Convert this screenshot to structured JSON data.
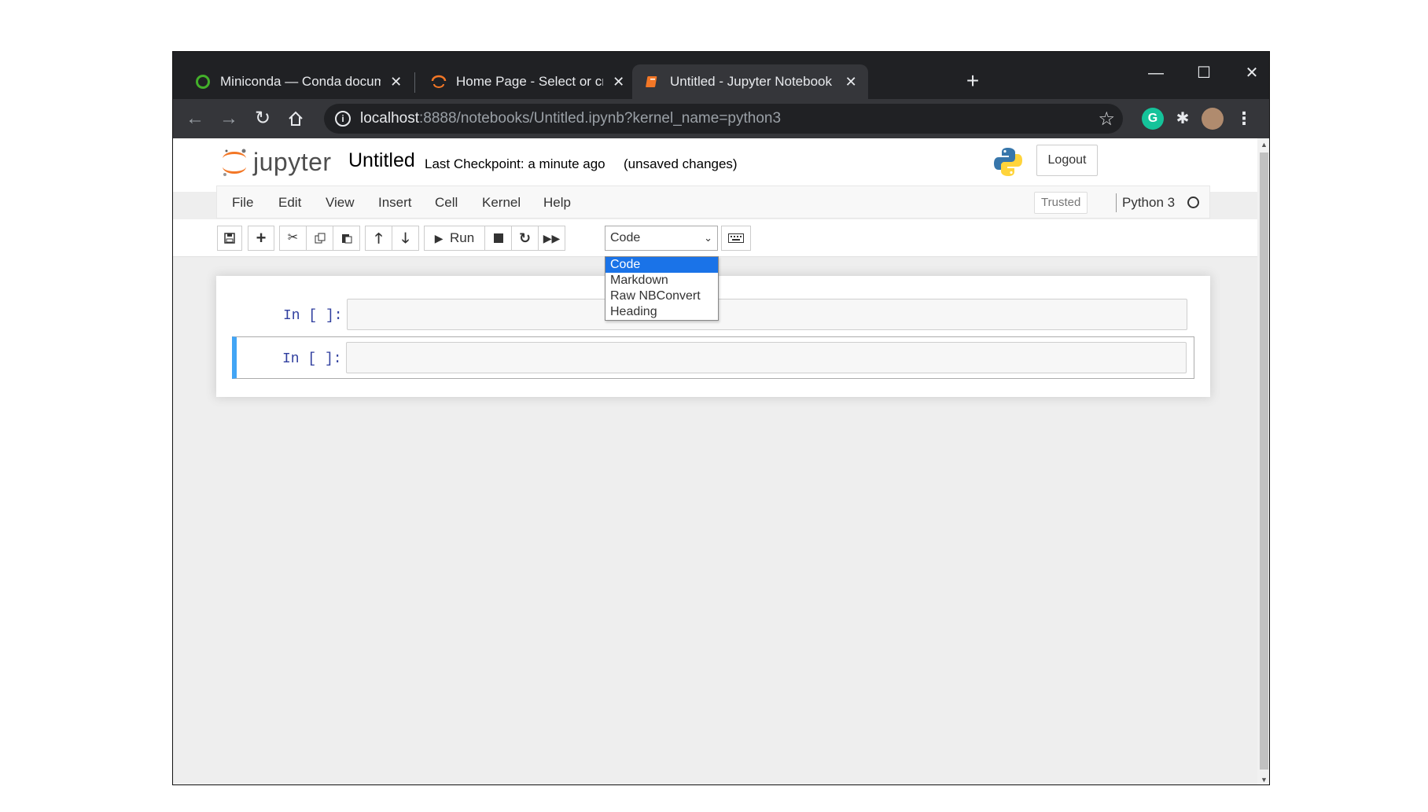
{
  "browser": {
    "tabs": [
      {
        "title": "Miniconda — Conda documentation",
        "close": "✕"
      },
      {
        "title": "Home Page - Select or create a notebook",
        "close": "✕"
      },
      {
        "title": "Untitled - Jupyter Notebook",
        "close": "✕"
      }
    ],
    "new_tab": "+",
    "window_controls": {
      "minimize": "—",
      "maximize": "☐",
      "close": "✕"
    },
    "url_host": "localhost",
    "url_rest": ":8888/notebooks/Untitled.ipynb?kernel_name=python3",
    "extension_grammarly": "G"
  },
  "jupyter": {
    "logo_text": "jupyter",
    "notebook_name": "Untitled",
    "checkpoint": "Last Checkpoint: a minute ago",
    "unsaved": "(unsaved changes)",
    "logout": "Logout",
    "menu": [
      "File",
      "Edit",
      "View",
      "Insert",
      "Cell",
      "Kernel",
      "Help"
    ],
    "trusted": "Trusted",
    "kernel_name": "Python 3",
    "toolbar": {
      "run_label": "Run",
      "cell_type_selected": "Code"
    },
    "cell_type_options": [
      "Code",
      "Markdown",
      "Raw NBConvert",
      "Heading"
    ],
    "cells": [
      {
        "prompt": "In [ ]:",
        "content": ""
      },
      {
        "prompt": "In [ ]:",
        "content": ""
      }
    ]
  },
  "colors": {
    "accent_selected_cell": "#42a5f5",
    "jupyter_orange": "#f37726",
    "dropdown_highlight": "#1a73e8"
  }
}
